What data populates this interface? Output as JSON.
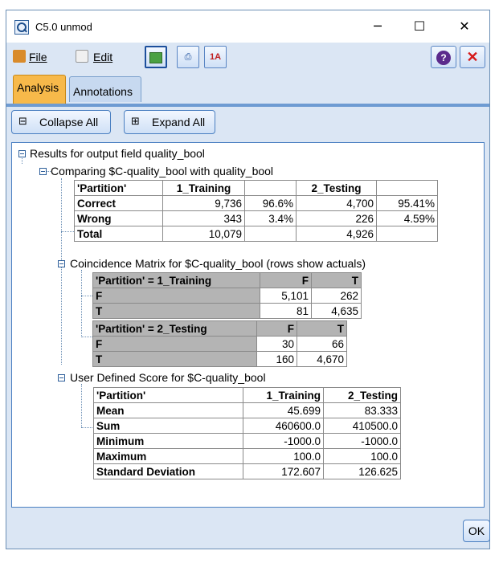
{
  "window": {
    "title": "C5.0 unmod",
    "minimize": "─",
    "maximize": "☐",
    "close": "✕"
  },
  "menu": {
    "file": "File",
    "edit": "Edit"
  },
  "tabs": [
    "Analysis",
    "Annotations"
  ],
  "buttons": {
    "collapse_all": "Collapse All",
    "expand_all": "Expand All",
    "ok": "OK"
  },
  "tree": {
    "root": "Results for output field quality_bool",
    "comparing": "Comparing $C-quality_bool with quality_bool",
    "coincidence": "Coincidence Matrix for $C-quality_bool (rows show actuals)",
    "uds": "User Defined Score for $C-quality_bool"
  },
  "comparison_table": {
    "headers": [
      "'Partition'",
      "1_Training",
      "",
      "2_Testing",
      ""
    ],
    "rows": [
      [
        "Correct",
        "9,736",
        "96.6%",
        "4,700",
        "95.41%"
      ],
      [
        "Wrong",
        "343",
        "3.4%",
        "226",
        "4.59%"
      ],
      [
        "Total",
        "10,079",
        "",
        "4,926",
        ""
      ]
    ]
  },
  "coincidence_training": {
    "header": [
      "'Partition' = 1_Training",
      "F",
      "T"
    ],
    "rows": [
      [
        "F",
        "5,101",
        "262"
      ],
      [
        "T",
        "81",
        "4,635"
      ]
    ]
  },
  "coincidence_testing": {
    "header": [
      "'Partition' = 2_Testing",
      "F",
      "T"
    ],
    "rows": [
      [
        "F",
        "30",
        "66"
      ],
      [
        "T",
        "160",
        "4,670"
      ]
    ]
  },
  "score_table": {
    "headers": [
      "'Partition'",
      "1_Training",
      "2_Testing"
    ],
    "rows": [
      [
        "Mean",
        "45.699",
        "83.333"
      ],
      [
        "Sum",
        "460600.0",
        "410500.0"
      ],
      [
        "Minimum",
        "-1000.0",
        "-1000.0"
      ],
      [
        "Maximum",
        "100.0",
        "100.0"
      ],
      [
        "Standard Deviation",
        "172.607",
        "126.625"
      ]
    ]
  },
  "icons": [
    "magnifier-app-icon",
    "file-icon",
    "edit-icon",
    "generate-icon",
    "print-icon",
    "sort-icon",
    "help-icon",
    "close-red-icon",
    "collapse-icon",
    "expand-icon"
  ],
  "colors": {
    "active_tab": "#f7b94a",
    "frame": "#dbe6f4",
    "accent": "#4a7fc1"
  }
}
